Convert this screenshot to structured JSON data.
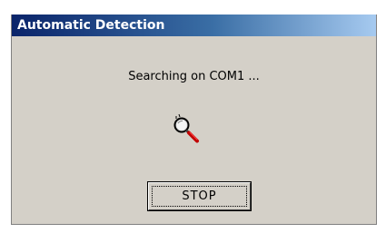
{
  "window": {
    "title": "Automatic Detection"
  },
  "status": {
    "text": "Searching on COM1 ..."
  },
  "icon": {
    "name": "search-magnifier-icon"
  },
  "button": {
    "label": "STOP"
  },
  "colors": {
    "titlebar_start": "#0a246a",
    "titlebar_end": "#a6caf0",
    "dialog_background": "#d4d0c8"
  }
}
